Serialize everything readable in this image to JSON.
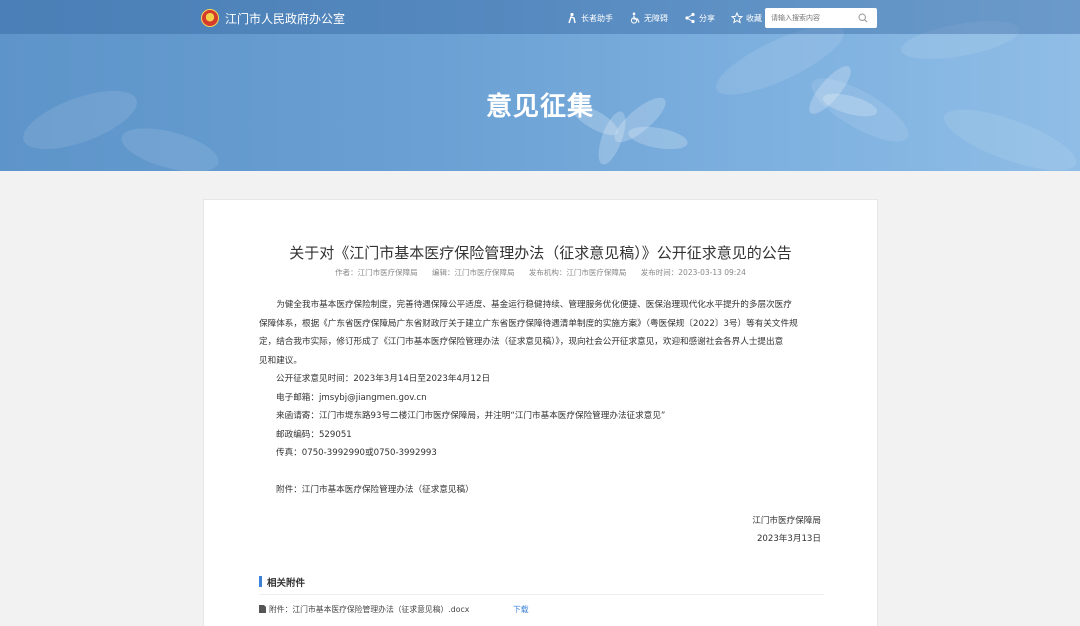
{
  "header": {
    "site_name": "江门市人民政府办公室",
    "tools": [
      {
        "label": "长者助手",
        "icon": "elder-icon"
      },
      {
        "label": "无障碍",
        "icon": "accessibility-icon"
      },
      {
        "label": "分享",
        "icon": "share-icon"
      },
      {
        "label": "收藏",
        "icon": "star-icon"
      }
    ],
    "search": {
      "placeholder": "请输入搜索内容"
    }
  },
  "banner": {
    "title": "意见征集"
  },
  "article": {
    "title": "关于对《江门市基本医疗保险管理办法（征求意见稿）》公开征求意见的公告",
    "meta": {
      "author": "作者：江门市医疗保障局",
      "editor": "编辑：江门市医疗保障局",
      "publisher": "发布机构：江门市医疗保障局",
      "date": "发布时间：2023-03-13 09:24"
    },
    "intro_1": "为健全我市基本医疗保险制度，完善待遇保障公平适度、基金运行稳健持续、管理服务优化便捷、医保治理现代化水平提升的多层次医疗",
    "intro_2": "保障体系，根据《广东省医疗保障局广东省财政厅关于建立广东省医疗保障待遇清单制度的实施方案》（粤医保规〔2022〕3号）等有关文件规",
    "intro_3": "定，结合我市实际，修订形成了《江门市基本医疗保险管理办法（征求意见稿）》，现向社会公开征求意见，欢迎和感谢社会各界人士提出意",
    "intro_4": "见和建议。",
    "period": "公开征求意见时间：2023年3月14日至2023年4月12日",
    "email": "电子邮箱：jmsybj@jiangmen.gov.cn",
    "mail": "来函请寄：江门市堤东路93号二楼江门市医疗保障局，并注明“江门市基本医疗保险管理办法征求意见”",
    "postcode": "邮政编码：529051",
    "fax": "传真：0750-3992990或0750-3992993",
    "attachment_note": "附件：江门市基本医疗保险管理办法（征求意见稿）",
    "sign_org": "江门市医疗保障局",
    "sign_date": "2023年3月13日"
  },
  "attachments": {
    "heading": "相关附件",
    "items": [
      {
        "name": "附件：江门市基本医疗保险管理办法（征求意见稿）.docx",
        "action": "下载"
      }
    ]
  }
}
